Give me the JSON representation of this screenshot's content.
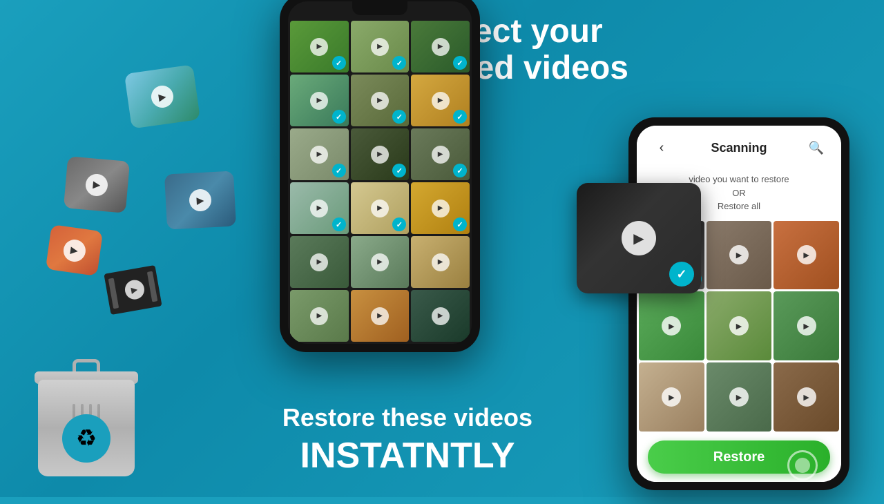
{
  "background": {
    "color": "#1a9fbd"
  },
  "top_right": {
    "line1": "Select your",
    "line2": "deleted videos"
  },
  "bottom_left": {
    "line1": "Restore these videos",
    "line2": "INSTATNTLY"
  },
  "right_phone": {
    "header": {
      "back_label": "‹",
      "title": "Scanning",
      "search_icon": "🔍"
    },
    "prompt": {
      "line1": "video you want to restore",
      "line2": "OR",
      "line3": "Restore all"
    },
    "restore_button_label": "Restore"
  },
  "trash": {
    "recycle_symbol": "♻"
  },
  "icons": {
    "play": "▶",
    "check": "✓",
    "back_arrow": "‹",
    "search": "⌕",
    "recycle": "♻"
  }
}
